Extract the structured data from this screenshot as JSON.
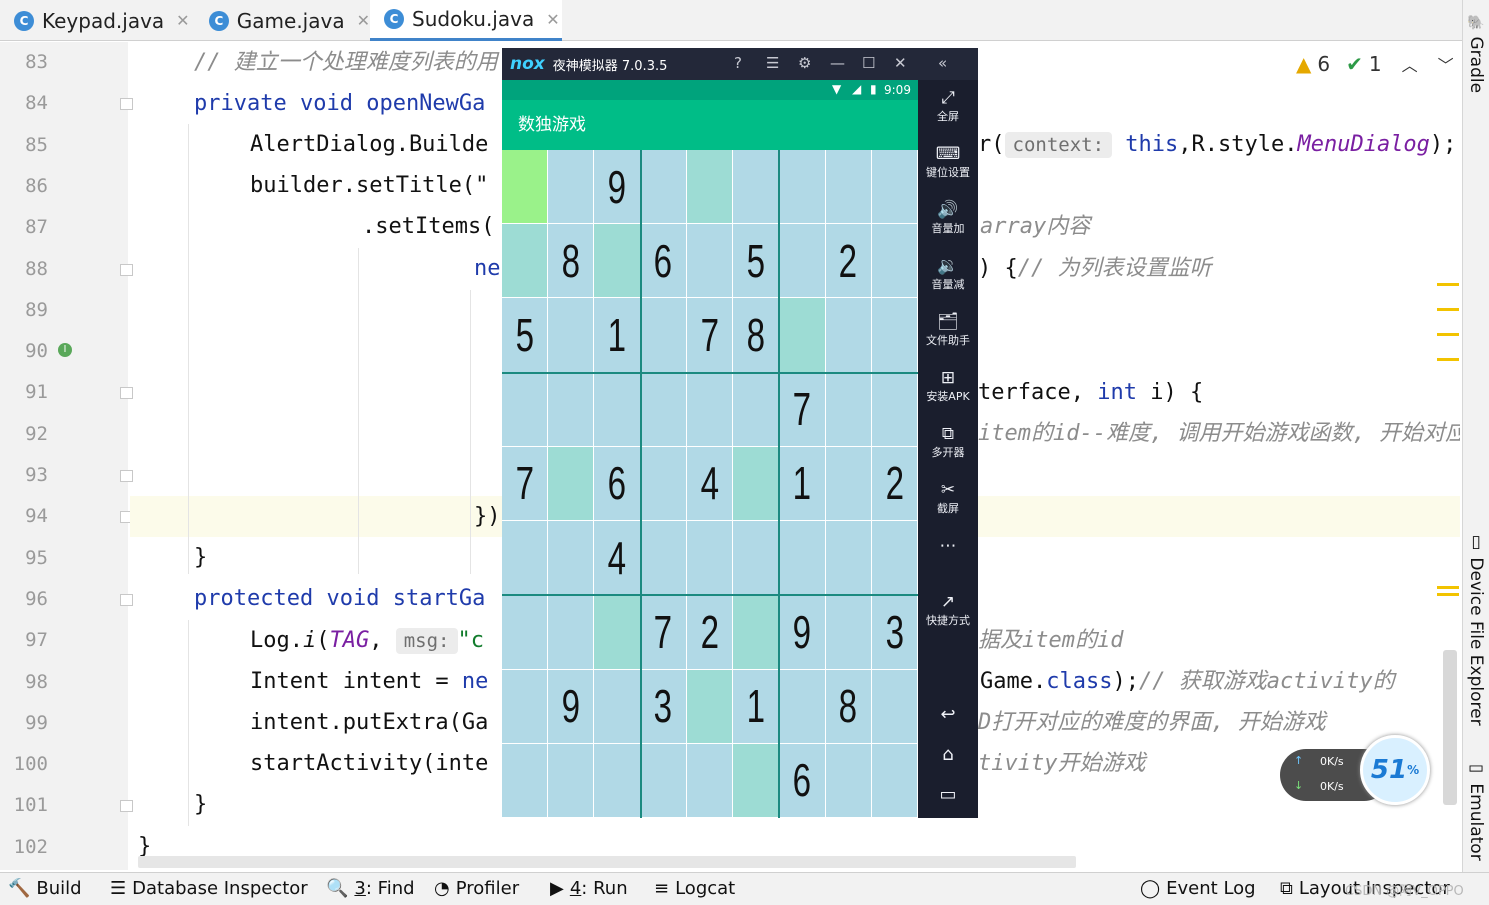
{
  "tabs": [
    {
      "label": "Keypad.java",
      "icon": "C"
    },
    {
      "label": "Game.java",
      "icon": "C"
    },
    {
      "label": "Sudoku.java",
      "icon": "C"
    }
  ],
  "inspection": {
    "warnings": "6",
    "ok": "1"
  },
  "line_numbers": [
    "83",
    "84",
    "85",
    "86",
    "87",
    "88",
    "89",
    "90",
    "91",
    "92",
    "93",
    "94",
    "95",
    "96",
    "97",
    "98",
    "99",
    "100",
    "101",
    "102"
  ],
  "code": {
    "l83": "// 建立一个处理难度列表的用",
    "l84a": "private",
    "l84b": "void",
    "l84c": "openNewGa",
    "l85a": "AlertDialog.Builde",
    "l85b": "r(",
    "l85hint": "context:",
    "l85c": "this",
    "l85d": ",R.style.",
    "l85e": "MenuDialog",
    "l85f": ");",
    "l86": "builder.setTitle(\"",
    "l87a": ".setItems(",
    "l87b": "array内容",
    "l88a": "ne",
    "l88b": ") {",
    "l88c": "// 为列表设置监听",
    "l91a": "terface, ",
    "l91b": "int",
    "l91c": " i) {",
    "l92": "item的id--难度, 调用开始游戏函数, 开始对应",
    "l94": "})",
    "l95": "}",
    "l96a": "protected",
    "l96b": "void",
    "l96c": "startGa",
    "l97a": "Log.",
    "l97b": "i",
    "l97c": "(",
    "l97d": "TAG",
    "l97e": ",",
    "l97hint": "msg:",
    "l97f": "\"c",
    "l97g": "据及item的id",
    "l98a": "Intent intent = ",
    "l98b": "ne",
    "l98c": "Game.",
    "l98d": "class",
    "l98e": ");",
    "l98f": "// 获取游戏activity的",
    "l99a": "intent.putExtra(Ga",
    "l99b": "D打开对应的难度的界面, 开始游戏",
    "l100a": "startActivity(inte",
    "l100b": "tivity开始游戏",
    "l101": "}",
    "l102": "}"
  },
  "right_tools": {
    "gradle": "Gradle",
    "device": "Device File Explorer",
    "emulator": "Emulator"
  },
  "bottom": {
    "build": "Build",
    "db": "Database Inspector",
    "find_num": "3",
    "find": ": Find",
    "profiler": "Profiler",
    "run_num": "4",
    "run": ": Run",
    "logcat": "Logcat",
    "eventlog": "Event Log",
    "layout": "Layout Inspector",
    "watermark": "CSDN @阿V_OPPO"
  },
  "emulator": {
    "logo": "nox",
    "title": "夜神模拟器 7.0.3.5",
    "time": "9:09",
    "app_title": "数独游戏",
    "side": [
      {
        "label": "全屏",
        "icon": "fullscreen-icon"
      },
      {
        "label": "键位设置",
        "icon": "keyboard-icon"
      },
      {
        "label": "音量加",
        "icon": "volume-up-icon"
      },
      {
        "label": "音量减",
        "icon": "volume-down-icon"
      },
      {
        "label": "文件助手",
        "icon": "file-icon"
      },
      {
        "label": "安装APK",
        "icon": "apk-icon"
      },
      {
        "label": "多开器",
        "icon": "multi-icon"
      },
      {
        "label": "截屏",
        "icon": "scissors-icon"
      },
      {
        "label": "",
        "icon": "more-icon"
      },
      {
        "label": "快捷方式",
        "icon": "shortcut-icon"
      }
    ],
    "colors": {
      "cell": "#b1d9e6",
      "highlight": "#9ddcd4",
      "selected": "#9af28a",
      "grid_thin": "#ffffff",
      "grid_thick": "#1b8a80",
      "appbar": "#00bd87"
    }
  },
  "sudoku": [
    [
      "",
      "",
      "9",
      "",
      "",
      "",
      "",
      "",
      ""
    ],
    [
      "",
      "8",
      "",
      "6",
      "",
      "5",
      "",
      "2",
      ""
    ],
    [
      "5",
      "",
      "1",
      "",
      "7",
      "8",
      "",
      "",
      ""
    ],
    [
      "",
      "",
      "",
      "",
      "",
      "",
      "7",
      "",
      ""
    ],
    [
      "7",
      "",
      "6",
      "",
      "4",
      "",
      "1",
      "",
      "2"
    ],
    [
      "",
      "",
      "4",
      "",
      "",
      "",
      "",
      "",
      ""
    ],
    [
      "",
      "",
      "",
      "7",
      "2",
      "",
      "9",
      "",
      "3"
    ],
    [
      "",
      "9",
      "",
      "3",
      "",
      "1",
      "",
      "8",
      ""
    ],
    [
      "",
      "",
      "",
      "",
      "",
      "",
      "6",
      "",
      ""
    ]
  ],
  "sudoku_highlight": [
    [
      0,
      4
    ],
    [
      1,
      0
    ],
    [
      1,
      2
    ],
    [
      2,
      6
    ],
    [
      4,
      1
    ],
    [
      4,
      5
    ],
    [
      6,
      2
    ],
    [
      6,
      5
    ],
    [
      7,
      4
    ],
    [
      8,
      5
    ]
  ],
  "sudoku_selected": [
    0,
    0
  ],
  "network": {
    "up": "0K/s",
    "down": "0K/s",
    "percent": "51",
    "unit": "%"
  }
}
